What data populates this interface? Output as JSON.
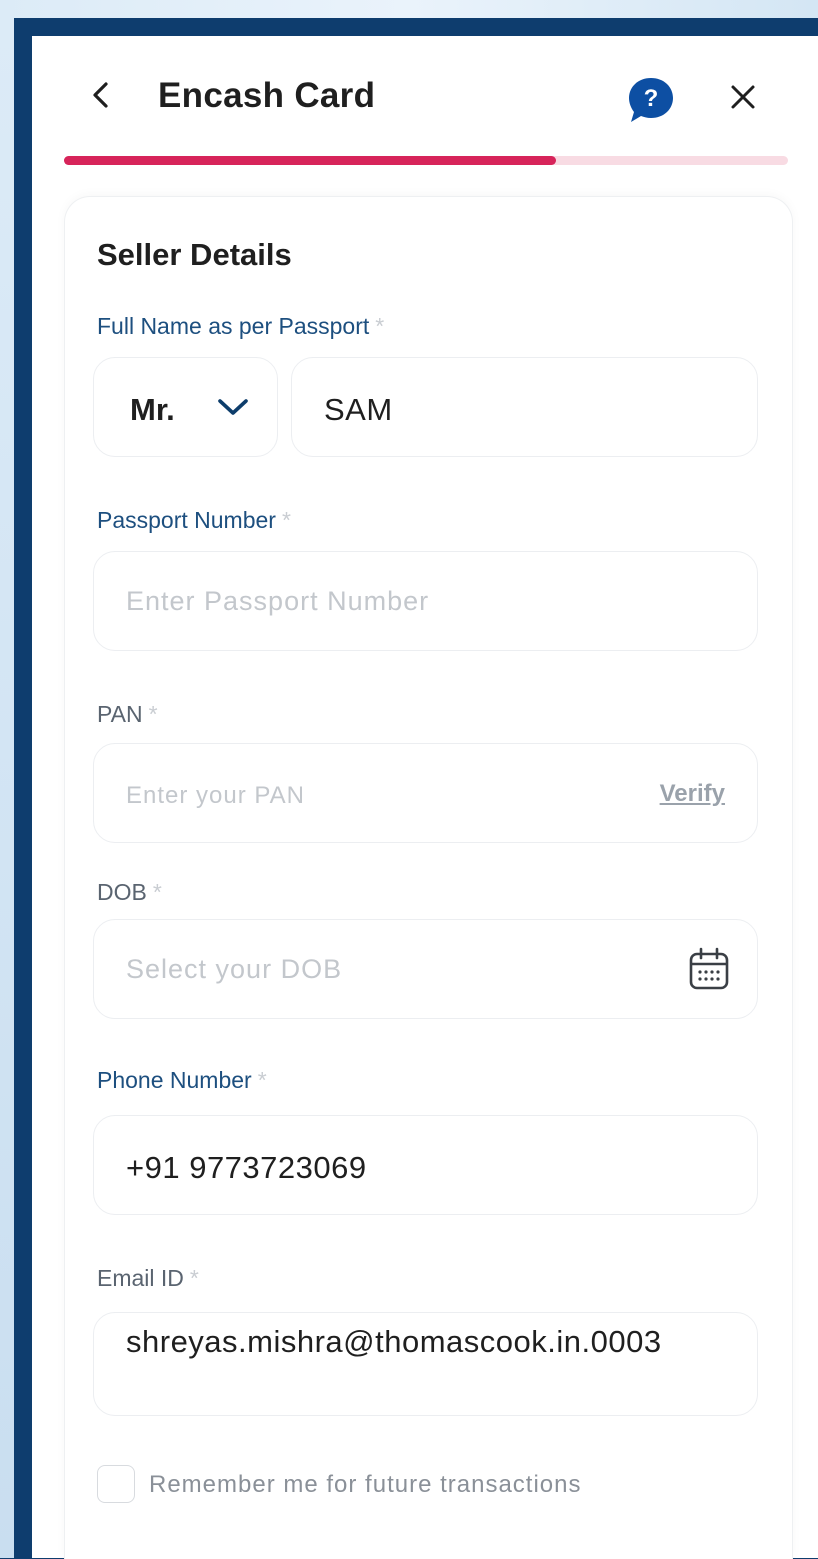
{
  "header": {
    "title": "Encash Card",
    "progress_percent": 68
  },
  "form": {
    "section_title": "Seller Details",
    "full_name": {
      "label": "Full Name as per Passport",
      "required_mark": "*",
      "salutation": "Mr.",
      "value": "SAM"
    },
    "passport": {
      "label": "Passport Number",
      "required_mark": "*",
      "placeholder": "Enter Passport Number"
    },
    "pan": {
      "label": "PAN",
      "required_mark": "*",
      "placeholder": "Enter your PAN",
      "verify_label": "Verify"
    },
    "dob": {
      "label": "DOB",
      "required_mark": "*",
      "placeholder": "Select your DOB"
    },
    "phone": {
      "label": "Phone Number",
      "required_mark": "*",
      "value": "+91 9773723069"
    },
    "email": {
      "label": "Email ID",
      "required_mark": "*",
      "value": "shreyas.mishra@thomascook.in.0003"
    },
    "remember_label": "Remember me for future transactions"
  },
  "colors": {
    "accent": "#d7245a",
    "label_blue": "#1d4f7f",
    "frame": "#0e3d6e",
    "help_icon": "#0d4fa3"
  }
}
